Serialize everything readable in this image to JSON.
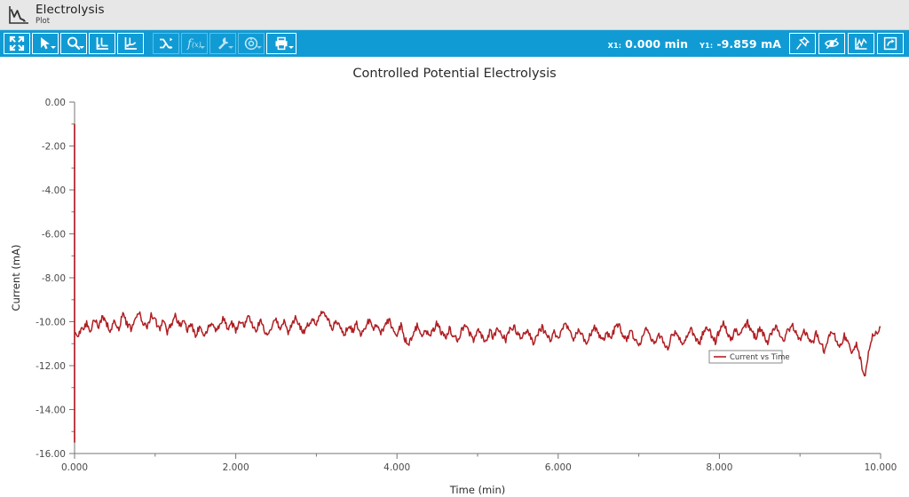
{
  "header": {
    "title": "Electrolysis",
    "subtitle": "Plot",
    "icon": "plot-curve-icon"
  },
  "toolbar": {
    "accent_color": "#119bd4",
    "buttons": [
      {
        "name": "fit-to-window-button",
        "icon": "expand-arrows-icon",
        "enabled": true,
        "has_caret": false
      },
      {
        "name": "select-tool-button",
        "icon": "cursor-arrow-icon",
        "enabled": true,
        "has_caret": true
      },
      {
        "name": "zoom-tool-button",
        "icon": "magnifier-icon",
        "enabled": true,
        "has_caret": true
      },
      {
        "name": "vertical-cursor-button",
        "icon": "axis-cursor-v-icon",
        "enabled": true,
        "has_caret": false
      },
      {
        "name": "free-cursor-button",
        "icon": "axis-cursor-free-icon",
        "enabled": true,
        "has_caret": false
      },
      {
        "name": "shuffle-traces-button",
        "icon": "shuffle-icon",
        "enabled": false,
        "has_caret": false
      },
      {
        "name": "function-button",
        "icon": "fx-icon",
        "enabled": false,
        "has_caret": true
      },
      {
        "name": "tools-button",
        "icon": "wrench-icon",
        "enabled": false,
        "has_caret": true
      },
      {
        "name": "settings-button",
        "icon": "gear-target-icon",
        "enabled": false,
        "has_caret": true
      },
      {
        "name": "print-button",
        "icon": "printer-icon",
        "enabled": true,
        "has_caret": true
      }
    ],
    "readouts": [
      {
        "label": "X1:",
        "value": "0.000 min"
      },
      {
        "label": "Y1:",
        "value": "-9.859 mA"
      }
    ],
    "right_buttons": [
      {
        "name": "pin-annotation-button",
        "icon": "pushpin-icon"
      },
      {
        "name": "hide-trace-button",
        "icon": "eye-crossed-icon"
      },
      {
        "name": "axis-options-button",
        "icon": "plot-axes-icon"
      },
      {
        "name": "export-button",
        "icon": "export-arrow-icon"
      }
    ]
  },
  "chart_data": {
    "type": "line",
    "title": "Controlled Potential Electrolysis",
    "xlabel": "Time (min)",
    "ylabel": "Current (mA)",
    "xlim": [
      0,
      10
    ],
    "ylim": [
      -16,
      0
    ],
    "grid": false,
    "legend_position": "inside-right",
    "x_ticks": [
      "0.000",
      "2.000",
      "4.000",
      "6.000",
      "8.000",
      "10.000"
    ],
    "x_tick_values": [
      0,
      2,
      4,
      6,
      8,
      10
    ],
    "x_minor_step": 1,
    "y_ticks": [
      "0.00",
      "-2.00",
      "-4.00",
      "-6.00",
      "-8.00",
      "-10.00",
      "-12.00",
      "-14.00",
      "-16.00"
    ],
    "y_tick_values": [
      0,
      -2,
      -4,
      -6,
      -8,
      -10,
      -12,
      -14,
      -16
    ],
    "y_minor_step": 1,
    "series": [
      {
        "name": "Current vs Time",
        "color": "#b01f24",
        "description": "Noisy electrolysis current trace with an initial vertical transient at t=0 spanning -1.0 to -15.5 mA, then steady noise around -10 mA slowly drifting to about -10.6 mA, with a deep spike to -12.6 mA near t=9.8 min.",
        "initial_transient": {
          "x": 0.0,
          "y_top": -1.0,
          "y_bottom": -15.5
        },
        "x": [
          0.0,
          0.05,
          0.1,
          0.15,
          0.2,
          0.25,
          0.3,
          0.35,
          0.4,
          0.45,
          0.5,
          0.55,
          0.6,
          0.65,
          0.7,
          0.75,
          0.8,
          0.85,
          0.9,
          0.95,
          1.0,
          1.05,
          1.1,
          1.15,
          1.2,
          1.25,
          1.3,
          1.35,
          1.4,
          1.45,
          1.5,
          1.55,
          1.6,
          1.65,
          1.7,
          1.75,
          1.8,
          1.85,
          1.9,
          1.95,
          2.0,
          2.05,
          2.1,
          2.15,
          2.2,
          2.25,
          2.3,
          2.35,
          2.4,
          2.45,
          2.5,
          2.55,
          2.6,
          2.65,
          2.7,
          2.75,
          2.8,
          2.85,
          2.9,
          2.95,
          3.0,
          3.05,
          3.1,
          3.15,
          3.2,
          3.25,
          3.3,
          3.35,
          3.4,
          3.45,
          3.5,
          3.55,
          3.6,
          3.65,
          3.7,
          3.75,
          3.8,
          3.85,
          3.9,
          3.95,
          4.0,
          4.05,
          4.1,
          4.15,
          4.2,
          4.25,
          4.3,
          4.35,
          4.4,
          4.45,
          4.5,
          4.55,
          4.6,
          4.65,
          4.7,
          4.75,
          4.8,
          4.85,
          4.9,
          4.95,
          5.0,
          5.05,
          5.1,
          5.15,
          5.2,
          5.25,
          5.3,
          5.35,
          5.4,
          5.45,
          5.5,
          5.55,
          5.6,
          5.65,
          5.7,
          5.75,
          5.8,
          5.85,
          5.9,
          5.95,
          6.0,
          6.05,
          6.1,
          6.15,
          6.2,
          6.25,
          6.3,
          6.35,
          6.4,
          6.45,
          6.5,
          6.55,
          6.6,
          6.65,
          6.7,
          6.75,
          6.8,
          6.85,
          6.9,
          6.95,
          7.0,
          7.05,
          7.1,
          7.15,
          7.2,
          7.25,
          7.3,
          7.35,
          7.4,
          7.45,
          7.5,
          7.55,
          7.6,
          7.65,
          7.7,
          7.75,
          7.8,
          7.85,
          7.9,
          7.95,
          8.0,
          8.05,
          8.1,
          8.15,
          8.2,
          8.25,
          8.3,
          8.35,
          8.4,
          8.45,
          8.5,
          8.55,
          8.6,
          8.65,
          8.7,
          8.75,
          8.8,
          8.85,
          8.9,
          8.95,
          9.0,
          9.05,
          9.1,
          9.15,
          9.2,
          9.25,
          9.3,
          9.35,
          9.4,
          9.45,
          9.5,
          9.55,
          9.6,
          9.65,
          9.7,
          9.75,
          9.8,
          9.85,
          9.9,
          9.95,
          10.0
        ],
        "y": [
          -10.45,
          -10.55,
          -10.3,
          -10.05,
          -10.4,
          -9.85,
          -10.25,
          -9.7,
          -10.15,
          -10.4,
          -9.95,
          -10.3,
          -9.6,
          -10.1,
          -10.35,
          -9.75,
          -9.55,
          -10.05,
          -10.3,
          -9.65,
          -9.9,
          -10.35,
          -10.0,
          -10.45,
          -10.1,
          -9.7,
          -10.2,
          -9.95,
          -10.4,
          -10.15,
          -10.6,
          -10.25,
          -10.75,
          -10.35,
          -10.0,
          -10.5,
          -10.1,
          -9.85,
          -10.3,
          -10.05,
          -10.45,
          -9.9,
          -10.2,
          -9.75,
          -10.15,
          -10.45,
          -9.95,
          -10.35,
          -10.6,
          -10.2,
          -9.9,
          -10.3,
          -10.0,
          -10.5,
          -10.15,
          -9.8,
          -10.25,
          -10.55,
          -10.1,
          -9.85,
          -10.2,
          -9.7,
          -9.6,
          -10.0,
          -10.35,
          -9.9,
          -10.25,
          -10.55,
          -10.15,
          -10.45,
          -10.05,
          -10.6,
          -10.25,
          -9.95,
          -10.35,
          -10.1,
          -10.5,
          -10.2,
          -9.9,
          -10.3,
          -10.55,
          -10.15,
          -10.8,
          -11.05,
          -10.5,
          -10.2,
          -10.6,
          -10.3,
          -10.7,
          -10.35,
          -10.05,
          -10.45,
          -10.75,
          -10.3,
          -10.6,
          -10.9,
          -10.4,
          -10.15,
          -10.55,
          -10.8,
          -10.35,
          -10.65,
          -10.95,
          -10.45,
          -10.7,
          -10.3,
          -10.6,
          -10.85,
          -10.4,
          -10.2,
          -10.55,
          -10.8,
          -10.35,
          -10.65,
          -11.0,
          -10.5,
          -10.25,
          -10.6,
          -10.85,
          -10.45,
          -10.7,
          -10.35,
          -10.1,
          -10.5,
          -10.8,
          -10.4,
          -10.65,
          -11.0,
          -10.55,
          -10.3,
          -10.6,
          -10.9,
          -10.45,
          -10.7,
          -10.35,
          -10.15,
          -10.55,
          -10.85,
          -10.45,
          -10.75,
          -11.1,
          -10.6,
          -10.35,
          -10.7,
          -11.05,
          -10.55,
          -10.85,
          -11.25,
          -10.75,
          -10.45,
          -10.8,
          -11.1,
          -10.6,
          -10.35,
          -10.7,
          -11.0,
          -10.5,
          -10.25,
          -10.6,
          -10.9,
          -10.4,
          -10.1,
          -10.5,
          -10.8,
          -10.35,
          -10.65,
          -10.3,
          -10.05,
          -10.45,
          -10.75,
          -10.3,
          -10.6,
          -10.95,
          -10.45,
          -10.2,
          -10.55,
          -10.85,
          -10.4,
          -10.15,
          -10.5,
          -10.8,
          -10.35,
          -10.65,
          -11.0,
          -10.55,
          -10.9,
          -11.3,
          -10.75,
          -10.45,
          -10.8,
          -11.15,
          -10.65,
          -10.95,
          -11.4,
          -11.05,
          -11.7,
          -12.55,
          -11.35,
          -10.7,
          -10.45,
          -10.25
        ]
      }
    ]
  }
}
